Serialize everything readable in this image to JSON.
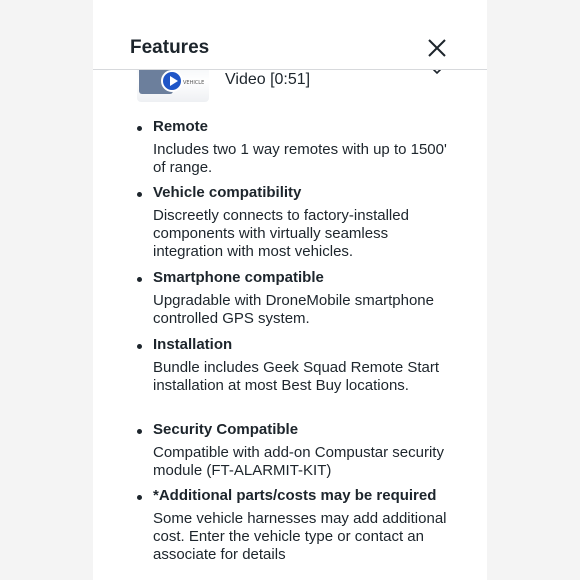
{
  "header": {
    "title": "Features"
  },
  "video": {
    "label": "Video [0:51]",
    "thumb_brand": "VEHICLE"
  },
  "features": [
    {
      "title": "Remote",
      "description": "Includes two 1 way remotes with up to 1500' of range."
    },
    {
      "title": "Vehicle compatibility",
      "description": "Discreetly connects to factory-installed components with virtually seamless integration with most vehicles."
    },
    {
      "title": "Smartphone compatible",
      "description": "Upgradable with DroneMobile smartphone controlled GPS system."
    },
    {
      "title": "Installation",
      "description": "Bundle includes Geek Squad Remote Start installation at most Best Buy locations."
    },
    {
      "title": "Security Compatible",
      "description": "Compatible with add-on Compustar security module (FT-ALARMIT-KIT)"
    },
    {
      "title": "*Additional parts/costs may be required",
      "description": "Some vehicle harnesses may add additional cost. Enter the vehicle type or contact an associate for details"
    }
  ],
  "colors": {
    "text": "#1d252c",
    "divider": "#d7d9dc",
    "play_button": "#1f55c7"
  },
  "icons": {
    "close": "close-icon",
    "chevron": "chevron-down-icon",
    "play": "play-icon"
  }
}
